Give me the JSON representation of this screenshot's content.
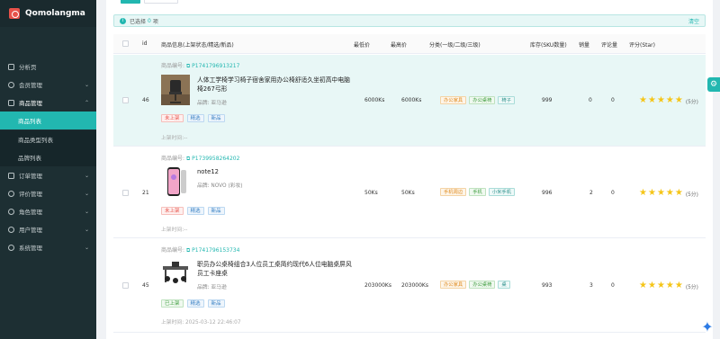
{
  "app": {
    "name": "Qomolangma"
  },
  "sidebar": {
    "items": [
      {
        "label": "分析页"
      },
      {
        "label": "会员管理"
      },
      {
        "label": "商品管理"
      },
      {
        "label": "商品列表"
      },
      {
        "label": "商品类型列表"
      },
      {
        "label": "品牌列表"
      },
      {
        "label": "订单管理"
      },
      {
        "label": "评价管理"
      },
      {
        "label": "角色管理"
      },
      {
        "label": "用户管理"
      },
      {
        "label": "系统管理"
      }
    ]
  },
  "selection": {
    "prefix": "已选择",
    "count": "0",
    "suffix": "项",
    "clear": "清空"
  },
  "table": {
    "headers": [
      "id",
      "商品信息(上架状态/精选/新品)",
      "最低价",
      "最高价",
      "分类(一级/二级/三级)",
      "库存(SKU数量)",
      "销量",
      "评论量",
      "评分(Star)"
    ],
    "code_prefix": "商品编号:",
    "time_prefix": "上架时间:",
    "rows": [
      {
        "id": "46",
        "code": "P1741796913217",
        "title": "人体工学椅学习椅子宿舍家用办公椅舒适久坐初高中电脑椅267弓形",
        "brand": "品牌: 亚马逊",
        "status": "未上架",
        "featured": "精选",
        "new": "新品",
        "time": "上架时间:--",
        "min_price": "6000Ks",
        "max_price": "6000Ks",
        "categories": [
          "办公家具",
          "办公桌椅",
          "椅子"
        ],
        "stock": "999",
        "sales": "0",
        "comments": "0",
        "score": "(5分)"
      },
      {
        "id": "21",
        "code": "P1739958264202",
        "title": "note12",
        "brand": "品牌: NOVO (彩妆)",
        "status": "未上架",
        "featured": "精选",
        "new": "新品",
        "time": "上架时间:--",
        "min_price": "50Ks",
        "max_price": "50Ks",
        "categories": [
          "手机周边",
          "手机",
          "小米手机"
        ],
        "stock": "996",
        "sales": "2",
        "comments": "0",
        "score": "(5分)"
      },
      {
        "id": "45",
        "code": "P1741796153734",
        "title": "职员办公桌椅组合3人位员工桌简约现代6人位电脑桌屏风员工卡座桌",
        "brand": "品牌: 亚马逊",
        "status": "已上架",
        "featured": "精选",
        "new": "新品",
        "time": "上架时间: 2025-03-12 22:46:07",
        "min_price": "203000Ks",
        "max_price": "203000Ks",
        "categories": [
          "办公家具",
          "办公桌椅",
          "桌"
        ],
        "stock": "993",
        "sales": "3",
        "comments": "0",
        "score": "(5分)"
      }
    ]
  },
  "icons": {
    "settings": "gear-icon",
    "assistant": "sparkle-icon"
  },
  "colors": {
    "accent": "#22b7b0",
    "sidebar": "#1d2f33",
    "star": "#f5c518"
  }
}
